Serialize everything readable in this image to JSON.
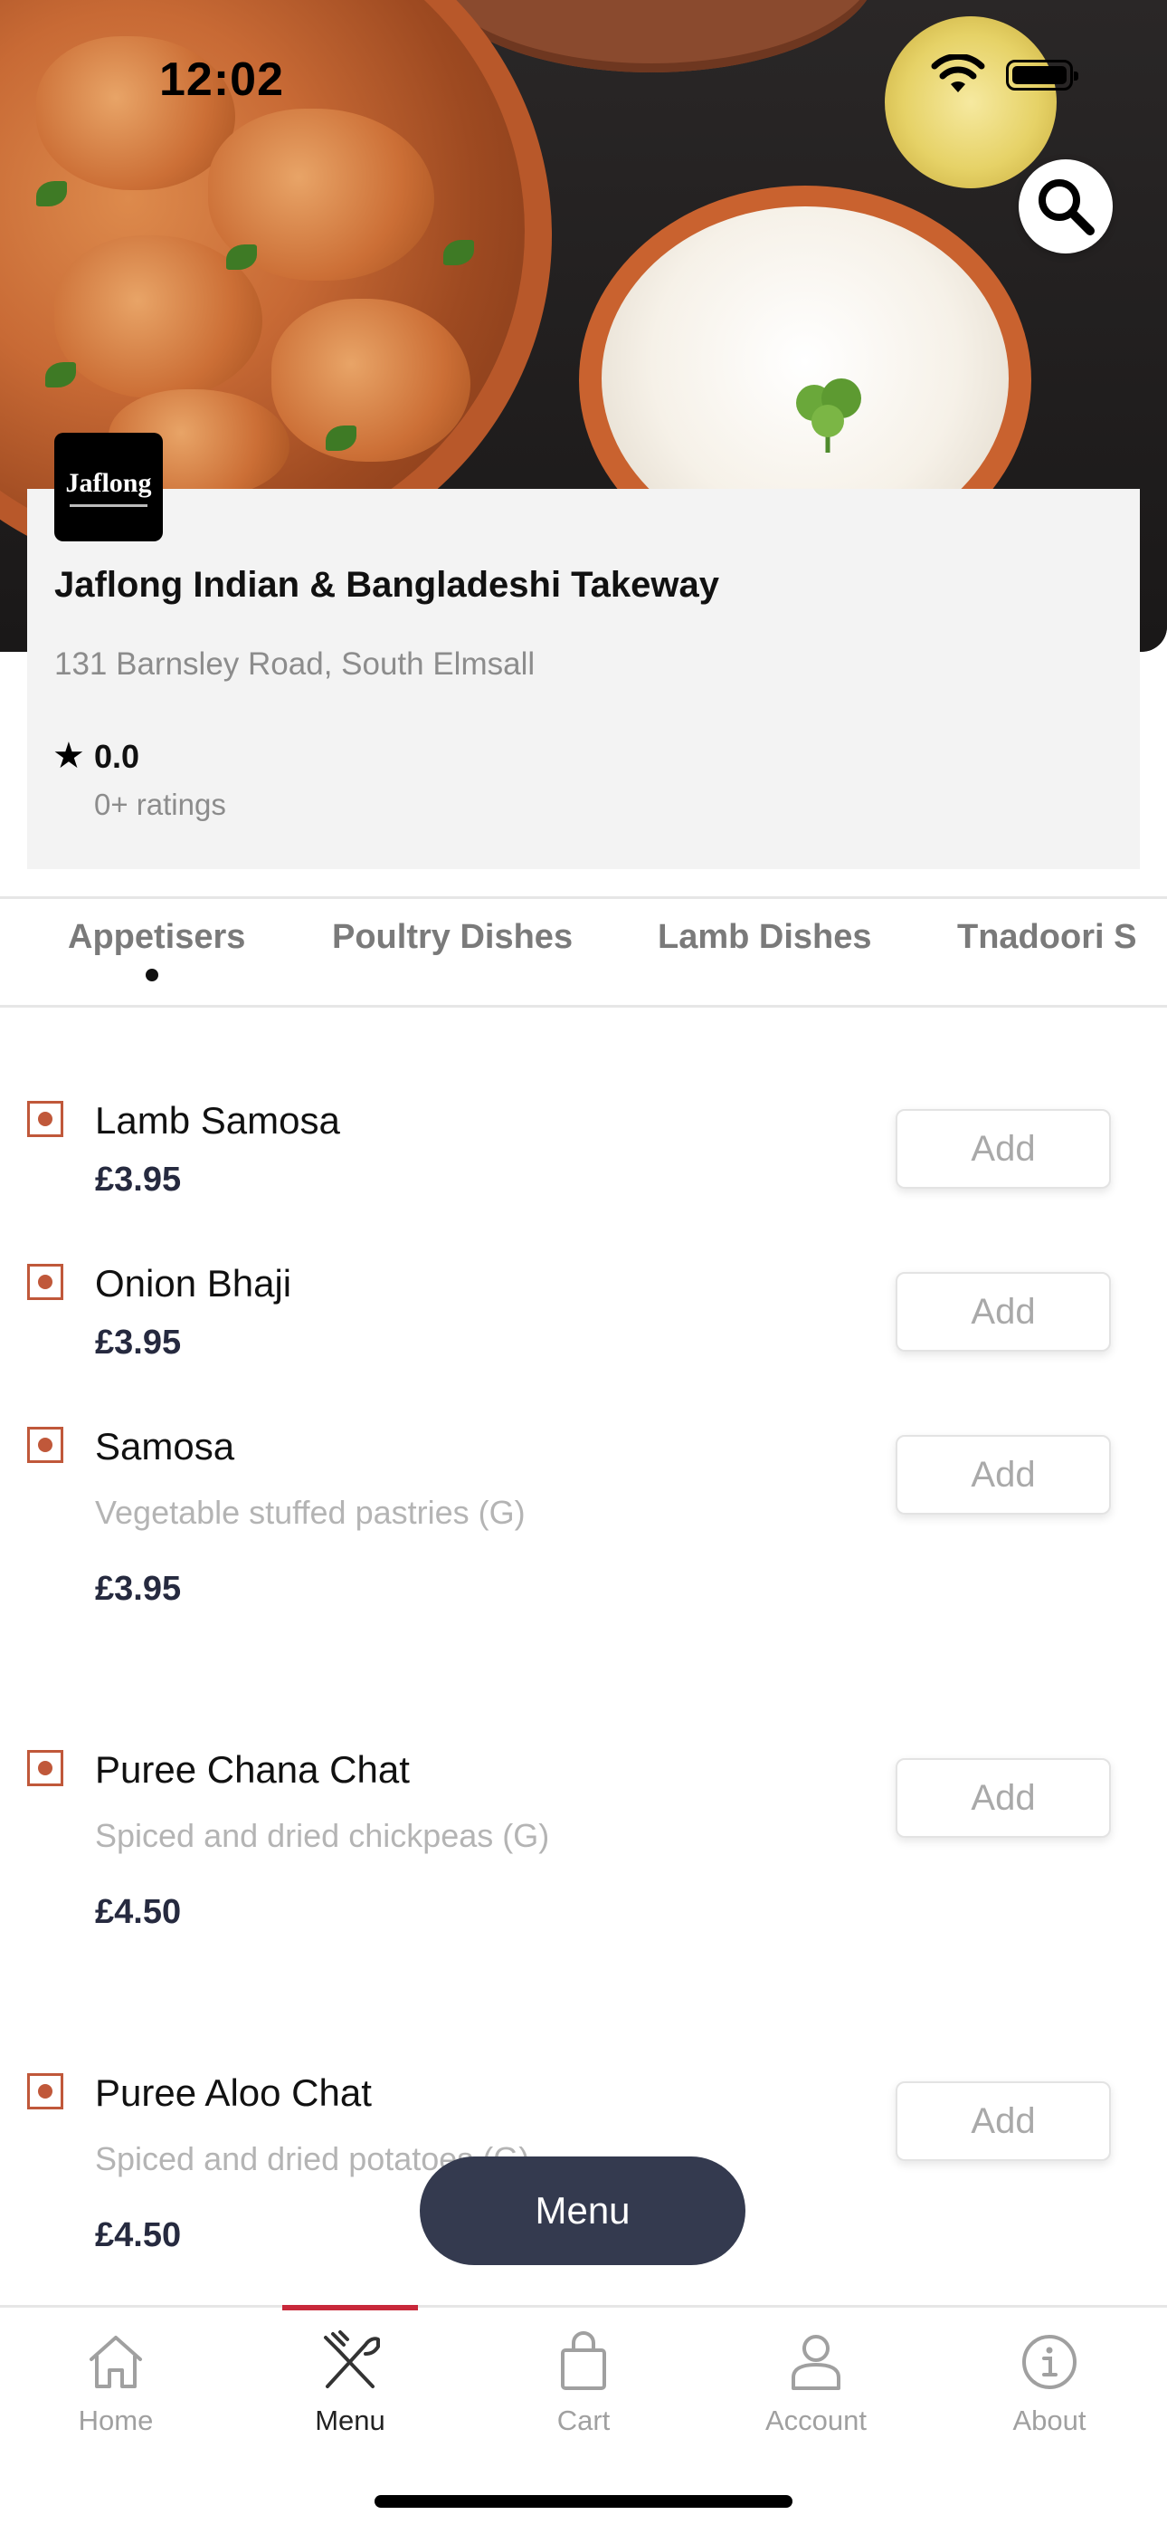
{
  "status_bar": {
    "time": "12:02"
  },
  "restaurant": {
    "logo_text": "Jaflong",
    "name": "Jaflong Indian & Bangladeshi Takeway",
    "address": "131 Barnsley Road, South Elmsall",
    "rating": "0.0",
    "rating_count": "0+ ratings"
  },
  "tabs": [
    {
      "label": "Appetisers",
      "active": true
    },
    {
      "label": "Poultry Dishes",
      "active": false
    },
    {
      "label": "Lamb Dishes",
      "active": false
    },
    {
      "label": "Tnadoori S",
      "active": false
    }
  ],
  "menu_items": [
    {
      "name": "Lamb Samosa",
      "description": "",
      "price": "£3.95",
      "add_label": "Add"
    },
    {
      "name": "Onion Bhaji",
      "description": "",
      "price": "£3.95",
      "add_label": "Add"
    },
    {
      "name": "Samosa",
      "description": "Vegetable stuffed pastries (G)",
      "price": "£3.95",
      "add_label": "Add"
    },
    {
      "name": "Puree Chana Chat",
      "description": "Spiced and dried chickpeas (G)",
      "price": "£4.50",
      "add_label": "Add"
    },
    {
      "name": "Puree Aloo Chat",
      "description": "Spiced and dried potatoes (G)",
      "price": "£4.50",
      "add_label": "Add"
    }
  ],
  "floating_menu_button": "Menu",
  "bottom_nav": [
    {
      "label": "Home",
      "icon": "home-icon",
      "active": false
    },
    {
      "label": "Menu",
      "icon": "fork-knife-icon",
      "active": true
    },
    {
      "label": "Cart",
      "icon": "shopping-bag-icon",
      "active": false
    },
    {
      "label": "Account",
      "icon": "person-icon",
      "active": false
    },
    {
      "label": "About",
      "icon": "info-icon",
      "active": false
    }
  ],
  "colors": {
    "accent_red": "#c8283a",
    "veg_marker": "#c0583a",
    "price_text": "#262a3f",
    "menu_fab": "#343a4f"
  }
}
